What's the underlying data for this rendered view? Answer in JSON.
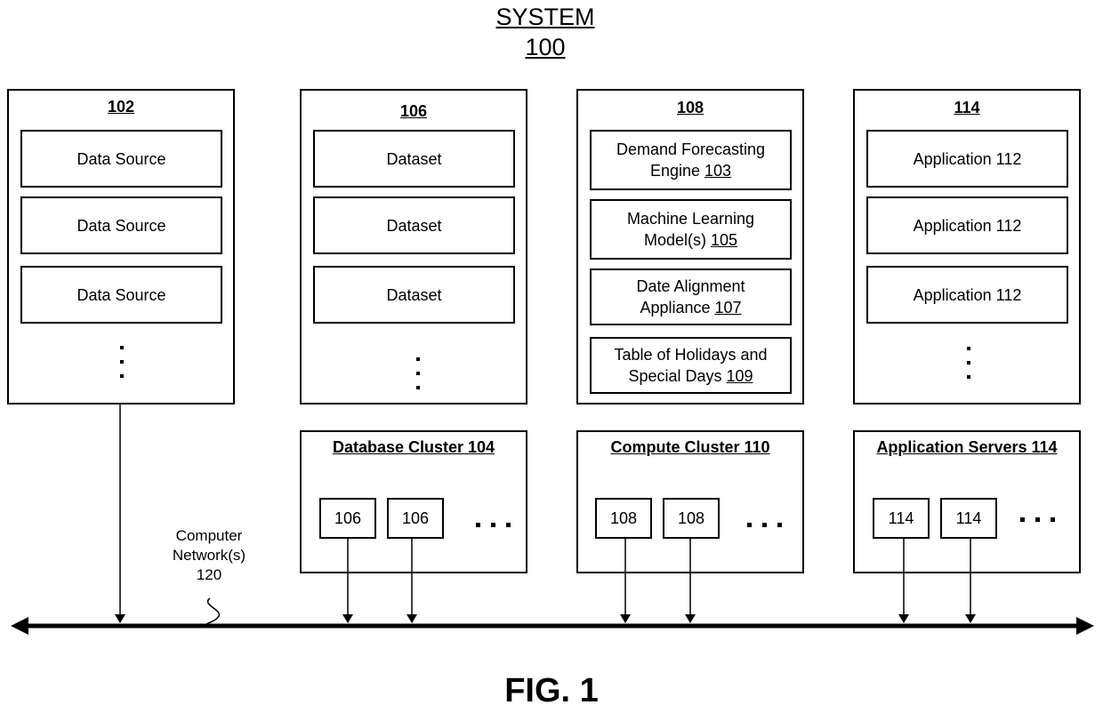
{
  "system": {
    "title": "SYSTEM",
    "number": "100"
  },
  "panels": [
    {
      "id": "102",
      "items": [
        "Data Source",
        "Data Source",
        "Data Source"
      ],
      "has_more": true
    },
    {
      "id": "106",
      "items": [
        "Dataset",
        "Dataset",
        "Dataset"
      ],
      "has_more": true
    },
    {
      "id": "108",
      "items": [
        {
          "text": "Demand Forecasting Engine",
          "ref": "103"
        },
        {
          "text": "Machine Learning Model(s)",
          "ref": "105"
        },
        {
          "text": "Date Alignment Appliance",
          "ref": "107"
        },
        {
          "text": "Table of Holidays and Special Days",
          "ref": "109"
        }
      ],
      "has_more": false
    },
    {
      "id": "114",
      "items": [
        "Application 112",
        "Application 112",
        "Application 112"
      ],
      "has_more": true
    }
  ],
  "item_lines": {
    "i108_0_a": "Demand Forecasting",
    "i108_0_b": "Engine ",
    "i108_1_a": "Machine Learning",
    "i108_1_b": "Model(s) ",
    "i108_2_a": "Date Alignment",
    "i108_2_b": "Appliance ",
    "i108_3_a": "Table of Holidays and",
    "i108_3_b": "Special Days "
  },
  "clusters": [
    {
      "title": "Database Cluster 104",
      "nodes": [
        "106",
        "106"
      ],
      "has_more": true
    },
    {
      "title": "Compute Cluster 110",
      "nodes": [
        "108",
        "108"
      ],
      "has_more": true
    },
    {
      "title": "Application Servers 114",
      "nodes": [
        "114",
        "114"
      ],
      "has_more": true
    }
  ],
  "network": {
    "line1": "Computer",
    "line2": "Network(s)",
    "line3": "120"
  },
  "figure_label": "FIG. 1"
}
